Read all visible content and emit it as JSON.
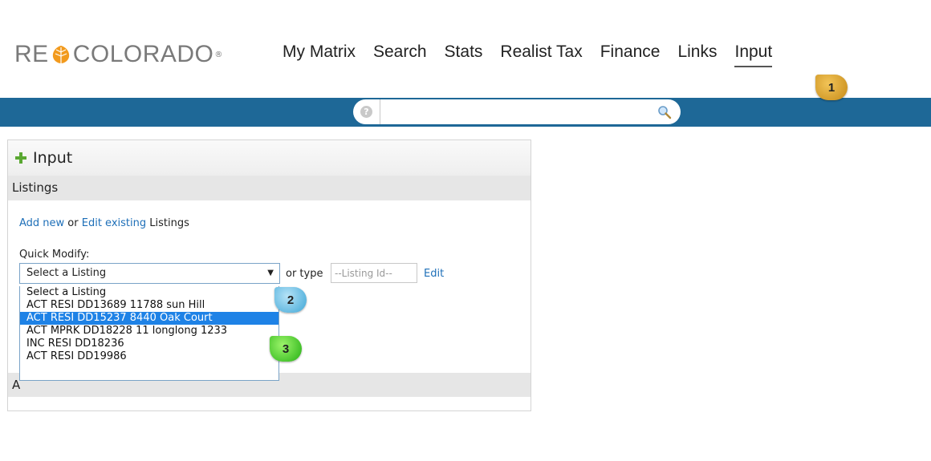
{
  "logo": {
    "text_left": "RE",
    "text_right": "COLORADO",
    "reg": "®"
  },
  "nav": {
    "items": [
      {
        "label": "My Matrix"
      },
      {
        "label": "Search"
      },
      {
        "label": "Stats"
      },
      {
        "label": "Realist Tax"
      },
      {
        "label": "Finance"
      },
      {
        "label": "Links"
      },
      {
        "label": "Input"
      }
    ],
    "active": "Input"
  },
  "search": {
    "value": "",
    "help_glyph": "?"
  },
  "panel": {
    "title": "Input",
    "section_listings": "Listings",
    "add_new": "Add new",
    "or_word": " or ",
    "edit_existing": "Edit existing",
    "listings_word": " Listings",
    "quick_modify_label": "Quick Modify:",
    "select_value": "Select a Listing",
    "or_type": "or type",
    "listing_id_placeholder": "--Listing Id--",
    "edit_label": "Edit",
    "section2_initial": "A"
  },
  "dropdown": {
    "options": [
      "Select a Listing",
      "ACT RESI DD13689 11788 sun Hill",
      "ACT RESI DD15237 8440 Oak Court",
      "ACT MPRK DD18228 11 longlong 1233",
      "INC RESI DD18236",
      "ACT RESI DD19986"
    ],
    "highlighted_index": 2
  },
  "badges": [
    "1",
    "2",
    "3"
  ],
  "colors": {
    "bluebar": "#1e6897",
    "link": "#1e6fb8",
    "highlight": "#1e82e6",
    "logo_orange": "#f29a1d",
    "badge1": "#d9a030",
    "badge2": "#5bb8e3",
    "badge3": "#3fd024"
  },
  "icons": [
    "leaf-logo-icon",
    "help-icon",
    "magnifier-icon",
    "plus-icon",
    "dropdown-arrow-icon"
  ]
}
